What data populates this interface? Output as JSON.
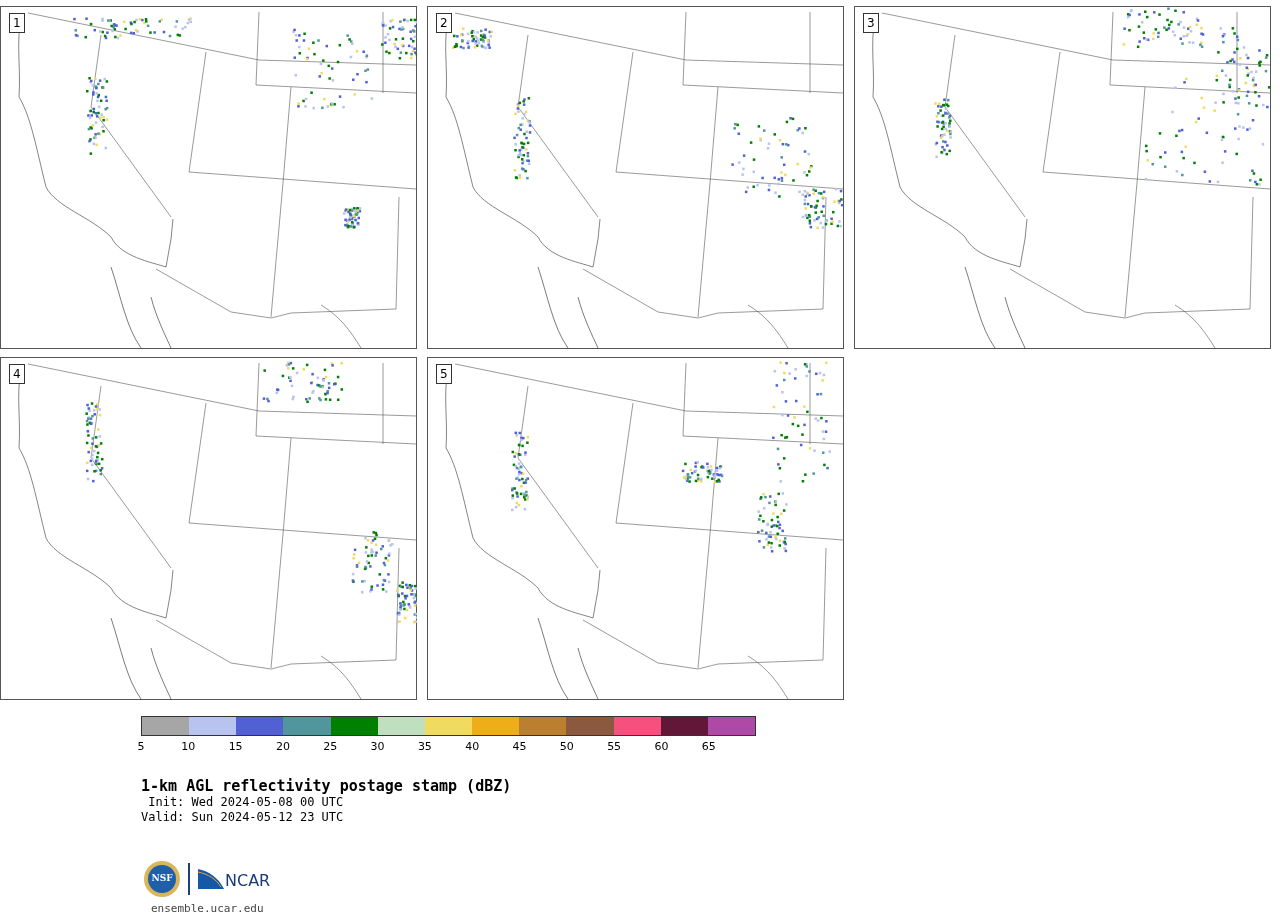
{
  "panels": [
    {
      "label": "1"
    },
    {
      "label": "2"
    },
    {
      "label": "3"
    },
    {
      "label": "4"
    },
    {
      "label": "5"
    }
  ],
  "colorbar": {
    "segments": [
      {
        "color": "#a6a6a6",
        "label": "5"
      },
      {
        "color": "#b8c3ef",
        "label": "10"
      },
      {
        "color": "#5260d6",
        "label": "15"
      },
      {
        "color": "#50969c",
        "label": "20"
      },
      {
        "color": "#008000",
        "label": "25"
      },
      {
        "color": "#bfdfbf",
        "label": "30"
      },
      {
        "color": "#f1db5f",
        "label": "35"
      },
      {
        "color": "#f0ad1a",
        "label": "40"
      },
      {
        "color": "#ba8030",
        "label": "45"
      },
      {
        "color": "#8b5a3e",
        "label": "50"
      },
      {
        "color": "#f5507e",
        "label": "55"
      },
      {
        "color": "#621638",
        "label": "60"
      },
      {
        "color": "#ae4aa5",
        "label": "65"
      }
    ]
  },
  "title": "1-km AGL reflectivity postage stamp (dBZ)",
  "init": " Init: Wed 2024-05-08 00 UTC",
  "valid": "Valid: Sun 2024-05-12 23 UTC",
  "logo": {
    "nsf": "NSF",
    "ncar": "NCAR"
  },
  "footer": "ensemble.ucar.edu"
}
